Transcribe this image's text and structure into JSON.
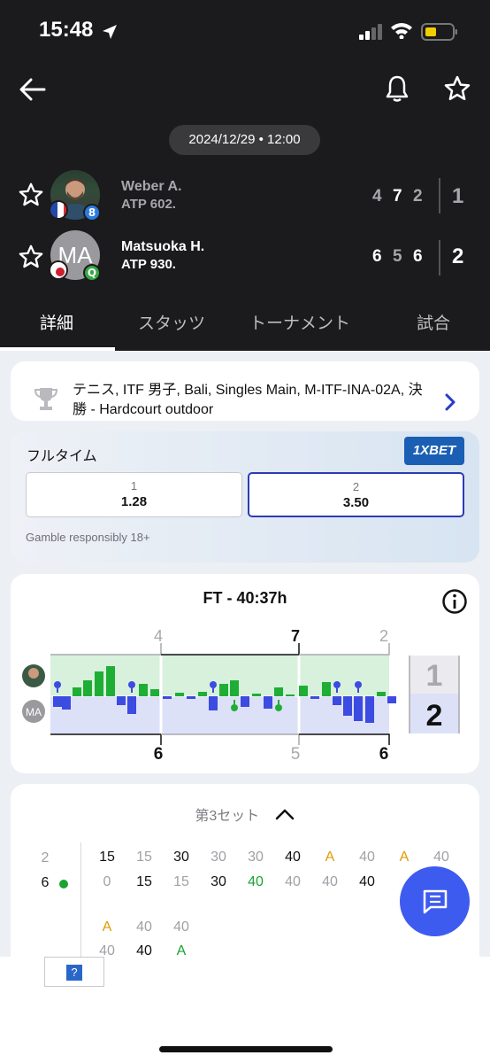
{
  "status_bar": {
    "time": "15:48"
  },
  "header": {
    "date": "2024/12/29 • 12:00"
  },
  "players": [
    {
      "name": "Weber A.",
      "rank": "ATP 602.",
      "games": [
        "4",
        "7",
        "2"
      ],
      "sets": "1",
      "badge": "8",
      "avatar_text": ""
    },
    {
      "name": "Matsuoka H.",
      "rank": "ATP 930.",
      "games": [
        "6",
        "5",
        "6"
      ],
      "sets": "2",
      "badge": "Q",
      "avatar_text": "MA"
    }
  ],
  "tabs": [
    {
      "label": "詳細",
      "active": true
    },
    {
      "label": "スタッツ",
      "active": false
    },
    {
      "label": "トーナメント",
      "active": false
    },
    {
      "label": "試合",
      "active": false
    }
  ],
  "tournament": {
    "text": "テニス, ITF 男子, Bali, Singles Main, M-ITF-INA-02A, 決勝 - Hardcourt outdoor"
  },
  "odds": {
    "title": "フルタイム",
    "bookmaker": "1XBET",
    "options": [
      {
        "label": "1",
        "value": "1.28"
      },
      {
        "label": "2",
        "value": "3.50"
      }
    ],
    "disclaimer": "Gamble responsibly 18+"
  },
  "momentum": {
    "title": "FT - 40:37h",
    "top_games": [
      "4",
      "7",
      "2"
    ],
    "bottom_games": [
      "6",
      "5",
      "6"
    ],
    "set_winner_top": "1",
    "set_winner_bottom": "2",
    "bottom_avatar_text": "MA",
    "colors": {
      "player1": "#1fae35",
      "player2": "#3c4be0",
      "player1_bg": "#d6f2dc",
      "player2_bg": "#dadff7"
    }
  },
  "point_by_point": {
    "header": "第3セット",
    "score_top": "2",
    "score_bottom": "6",
    "row1_top": [
      "15",
      "15",
      "30",
      "30",
      "30",
      "40",
      "A",
      "40",
      "A",
      "40"
    ],
    "row1_bottom": [
      "0",
      "15",
      "15",
      "30",
      "40",
      "40",
      "40",
      "40",
      "",
      ""
    ],
    "row2_top": [
      "A",
      "40",
      "40"
    ],
    "row2_bottom": [
      "40",
      "40",
      "A"
    ]
  },
  "help": {
    "label": "?"
  }
}
